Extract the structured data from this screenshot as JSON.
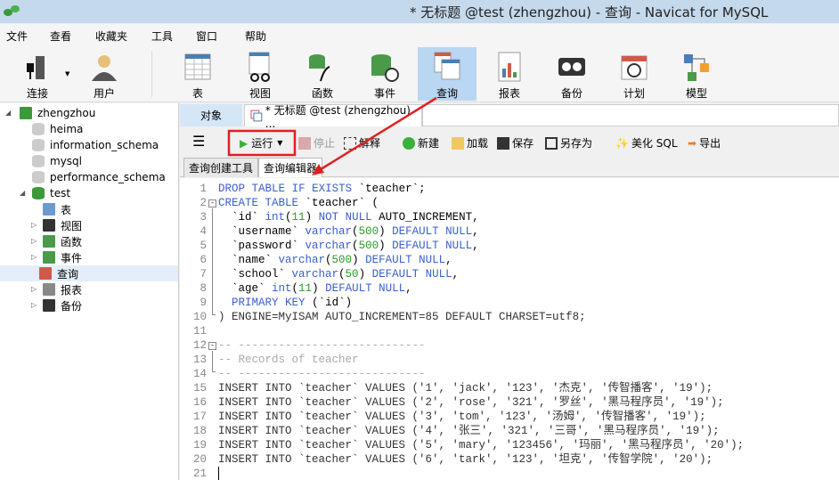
{
  "window": {
    "title": "* 无标题 @test (zhengzhou) - 查询 - Navicat for MySQL"
  },
  "menu": [
    "文件",
    "查看",
    "收藏夹",
    "工具",
    "窗口",
    "帮助"
  ],
  "toolbar": [
    {
      "label": "连接",
      "icon": "connection-icon"
    },
    {
      "label": "用户",
      "icon": "user-icon"
    },
    {
      "label": "表",
      "icon": "table-icon"
    },
    {
      "label": "视图",
      "icon": "view-icon"
    },
    {
      "label": "函数",
      "icon": "function-icon"
    },
    {
      "label": "事件",
      "icon": "event-icon"
    },
    {
      "label": "查询",
      "icon": "query-icon",
      "active": true
    },
    {
      "label": "报表",
      "icon": "report-icon"
    },
    {
      "label": "备份",
      "icon": "backup-icon"
    },
    {
      "label": "计划",
      "icon": "schedule-icon"
    },
    {
      "label": "模型",
      "icon": "model-icon"
    }
  ],
  "tree": {
    "connection": "zhengzhou",
    "databases": [
      "heima",
      "information_schema",
      "mysql",
      "performance_schema",
      "test"
    ],
    "test_children": [
      "表",
      "视图",
      "函数",
      "事件",
      "查询",
      "报表",
      "备份"
    ],
    "selected": "查询"
  },
  "tabs": {
    "objects": "对象",
    "query": "* 无标题 @test (zhengzhou) ..."
  },
  "query_toolbar": {
    "run": "运行",
    "stop": "停止",
    "explain": "解释",
    "new": "新建",
    "load": "加载",
    "save": "保存",
    "save_as": "另存为",
    "beautify": "美化 SQL",
    "export": "导出"
  },
  "subtabs": {
    "builder": "查询创建工具",
    "editor": "查询编辑器"
  },
  "colors": {
    "keyword": "#3a5fcd",
    "number": "#2a9a2a",
    "string": "#a52a2a",
    "comment": "#aaaaaa",
    "annotation": "#e02020",
    "active_toolbar": "#b9d6f2"
  },
  "editor": {
    "lines": [
      "DROP TABLE IF EXISTS `teacher`;",
      "CREATE TABLE `teacher` (",
      "  `id` int(11) NOT NULL AUTO_INCREMENT,",
      "  `username` varchar(500) DEFAULT NULL,",
      "  `password` varchar(500) DEFAULT NULL,",
      "  `name` varchar(500) DEFAULT NULL,",
      "  `school` varchar(50) DEFAULT NULL,",
      "  `age` int(11) DEFAULT NULL,",
      "  PRIMARY KEY (`id`)",
      ") ENGINE=MyISAM AUTO_INCREMENT=85 DEFAULT CHARSET=utf8;",
      "",
      "-- ----------------------------",
      "-- Records of teacher",
      "-- ----------------------------",
      "INSERT INTO `teacher` VALUES ('1', 'jack', '123', '杰克', '传智播客', '19');",
      "INSERT INTO `teacher` VALUES ('2', 'rose', '321', '罗丝', '黑马程序员', '19');",
      "INSERT INTO `teacher` VALUES ('3', 'tom', '123', '汤姆', '传智播客', '19');",
      "INSERT INTO `teacher` VALUES ('4', '张三', '321', '三哥', '黑马程序员', '19');",
      "INSERT INTO `teacher` VALUES ('5', 'mary', '123456', '玛丽', '黑马程序员', '20');",
      "INSERT INTO `teacher` VALUES ('6', 'tark', '123', '坦克', '传智学院', '20');",
      ""
    ]
  }
}
